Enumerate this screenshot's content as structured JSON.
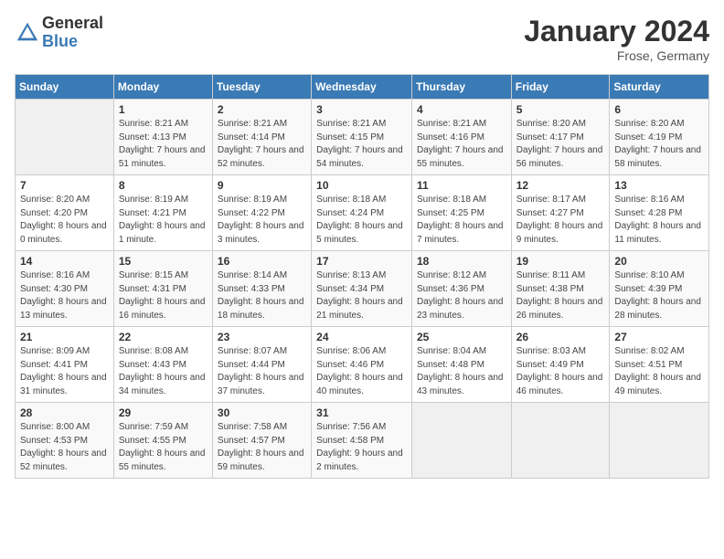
{
  "header": {
    "logo_general": "General",
    "logo_blue": "Blue",
    "month_title": "January 2024",
    "location": "Frose, Germany"
  },
  "days_of_week": [
    "Sunday",
    "Monday",
    "Tuesday",
    "Wednesday",
    "Thursday",
    "Friday",
    "Saturday"
  ],
  "weeks": [
    [
      {
        "num": "",
        "sunrise": "",
        "sunset": "",
        "daylight": ""
      },
      {
        "num": "1",
        "sunrise": "Sunrise: 8:21 AM",
        "sunset": "Sunset: 4:13 PM",
        "daylight": "Daylight: 7 hours and 51 minutes."
      },
      {
        "num": "2",
        "sunrise": "Sunrise: 8:21 AM",
        "sunset": "Sunset: 4:14 PM",
        "daylight": "Daylight: 7 hours and 52 minutes."
      },
      {
        "num": "3",
        "sunrise": "Sunrise: 8:21 AM",
        "sunset": "Sunset: 4:15 PM",
        "daylight": "Daylight: 7 hours and 54 minutes."
      },
      {
        "num": "4",
        "sunrise": "Sunrise: 8:21 AM",
        "sunset": "Sunset: 4:16 PM",
        "daylight": "Daylight: 7 hours and 55 minutes."
      },
      {
        "num": "5",
        "sunrise": "Sunrise: 8:20 AM",
        "sunset": "Sunset: 4:17 PM",
        "daylight": "Daylight: 7 hours and 56 minutes."
      },
      {
        "num": "6",
        "sunrise": "Sunrise: 8:20 AM",
        "sunset": "Sunset: 4:19 PM",
        "daylight": "Daylight: 7 hours and 58 minutes."
      }
    ],
    [
      {
        "num": "7",
        "sunrise": "Sunrise: 8:20 AM",
        "sunset": "Sunset: 4:20 PM",
        "daylight": "Daylight: 8 hours and 0 minutes."
      },
      {
        "num": "8",
        "sunrise": "Sunrise: 8:19 AM",
        "sunset": "Sunset: 4:21 PM",
        "daylight": "Daylight: 8 hours and 1 minute."
      },
      {
        "num": "9",
        "sunrise": "Sunrise: 8:19 AM",
        "sunset": "Sunset: 4:22 PM",
        "daylight": "Daylight: 8 hours and 3 minutes."
      },
      {
        "num": "10",
        "sunrise": "Sunrise: 8:18 AM",
        "sunset": "Sunset: 4:24 PM",
        "daylight": "Daylight: 8 hours and 5 minutes."
      },
      {
        "num": "11",
        "sunrise": "Sunrise: 8:18 AM",
        "sunset": "Sunset: 4:25 PM",
        "daylight": "Daylight: 8 hours and 7 minutes."
      },
      {
        "num": "12",
        "sunrise": "Sunrise: 8:17 AM",
        "sunset": "Sunset: 4:27 PM",
        "daylight": "Daylight: 8 hours and 9 minutes."
      },
      {
        "num": "13",
        "sunrise": "Sunrise: 8:16 AM",
        "sunset": "Sunset: 4:28 PM",
        "daylight": "Daylight: 8 hours and 11 minutes."
      }
    ],
    [
      {
        "num": "14",
        "sunrise": "Sunrise: 8:16 AM",
        "sunset": "Sunset: 4:30 PM",
        "daylight": "Daylight: 8 hours and 13 minutes."
      },
      {
        "num": "15",
        "sunrise": "Sunrise: 8:15 AM",
        "sunset": "Sunset: 4:31 PM",
        "daylight": "Daylight: 8 hours and 16 minutes."
      },
      {
        "num": "16",
        "sunrise": "Sunrise: 8:14 AM",
        "sunset": "Sunset: 4:33 PM",
        "daylight": "Daylight: 8 hours and 18 minutes."
      },
      {
        "num": "17",
        "sunrise": "Sunrise: 8:13 AM",
        "sunset": "Sunset: 4:34 PM",
        "daylight": "Daylight: 8 hours and 21 minutes."
      },
      {
        "num": "18",
        "sunrise": "Sunrise: 8:12 AM",
        "sunset": "Sunset: 4:36 PM",
        "daylight": "Daylight: 8 hours and 23 minutes."
      },
      {
        "num": "19",
        "sunrise": "Sunrise: 8:11 AM",
        "sunset": "Sunset: 4:38 PM",
        "daylight": "Daylight: 8 hours and 26 minutes."
      },
      {
        "num": "20",
        "sunrise": "Sunrise: 8:10 AM",
        "sunset": "Sunset: 4:39 PM",
        "daylight": "Daylight: 8 hours and 28 minutes."
      }
    ],
    [
      {
        "num": "21",
        "sunrise": "Sunrise: 8:09 AM",
        "sunset": "Sunset: 4:41 PM",
        "daylight": "Daylight: 8 hours and 31 minutes."
      },
      {
        "num": "22",
        "sunrise": "Sunrise: 8:08 AM",
        "sunset": "Sunset: 4:43 PM",
        "daylight": "Daylight: 8 hours and 34 minutes."
      },
      {
        "num": "23",
        "sunrise": "Sunrise: 8:07 AM",
        "sunset": "Sunset: 4:44 PM",
        "daylight": "Daylight: 8 hours and 37 minutes."
      },
      {
        "num": "24",
        "sunrise": "Sunrise: 8:06 AM",
        "sunset": "Sunset: 4:46 PM",
        "daylight": "Daylight: 8 hours and 40 minutes."
      },
      {
        "num": "25",
        "sunrise": "Sunrise: 8:04 AM",
        "sunset": "Sunset: 4:48 PM",
        "daylight": "Daylight: 8 hours and 43 minutes."
      },
      {
        "num": "26",
        "sunrise": "Sunrise: 8:03 AM",
        "sunset": "Sunset: 4:49 PM",
        "daylight": "Daylight: 8 hours and 46 minutes."
      },
      {
        "num": "27",
        "sunrise": "Sunrise: 8:02 AM",
        "sunset": "Sunset: 4:51 PM",
        "daylight": "Daylight: 8 hours and 49 minutes."
      }
    ],
    [
      {
        "num": "28",
        "sunrise": "Sunrise: 8:00 AM",
        "sunset": "Sunset: 4:53 PM",
        "daylight": "Daylight: 8 hours and 52 minutes."
      },
      {
        "num": "29",
        "sunrise": "Sunrise: 7:59 AM",
        "sunset": "Sunset: 4:55 PM",
        "daylight": "Daylight: 8 hours and 55 minutes."
      },
      {
        "num": "30",
        "sunrise": "Sunrise: 7:58 AM",
        "sunset": "Sunset: 4:57 PM",
        "daylight": "Daylight: 8 hours and 59 minutes."
      },
      {
        "num": "31",
        "sunrise": "Sunrise: 7:56 AM",
        "sunset": "Sunset: 4:58 PM",
        "daylight": "Daylight: 9 hours and 2 minutes."
      },
      {
        "num": "",
        "sunrise": "",
        "sunset": "",
        "daylight": ""
      },
      {
        "num": "",
        "sunrise": "",
        "sunset": "",
        "daylight": ""
      },
      {
        "num": "",
        "sunrise": "",
        "sunset": "",
        "daylight": ""
      }
    ]
  ]
}
